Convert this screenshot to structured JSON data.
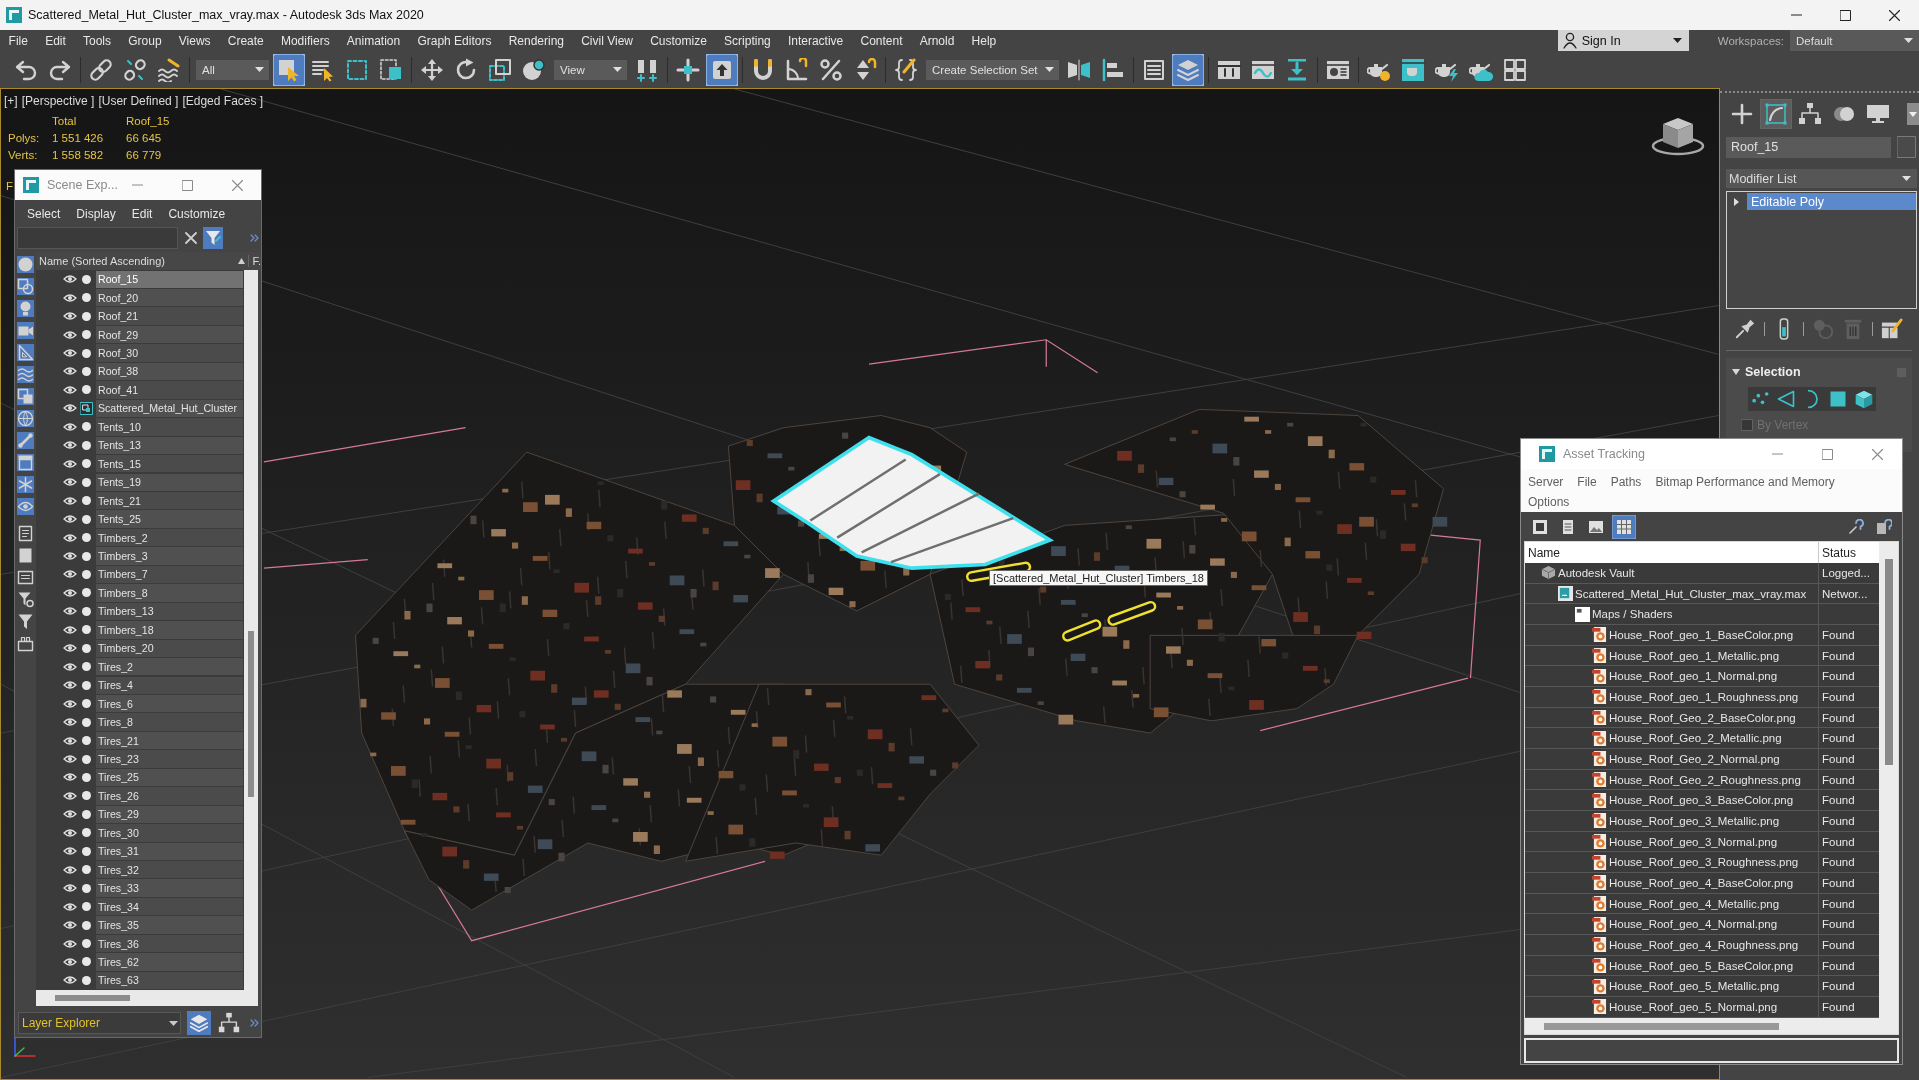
{
  "window": {
    "title": "Scattered_Metal_Hut_Cluster_max_vray.max - Autodesk 3ds Max 2020"
  },
  "menu": [
    "File",
    "Edit",
    "Tools",
    "Group",
    "Views",
    "Create",
    "Modifiers",
    "Animation",
    "Graph Editors",
    "Rendering",
    "Civil View",
    "Customize",
    "Scripting",
    "Interactive",
    "Content",
    "Arnold",
    "Help"
  ],
  "account": {
    "label": "Sign In"
  },
  "workspaces": {
    "label": "Workspaces:",
    "value": "Default"
  },
  "toolbar": [
    {
      "kind": "button",
      "selected": false
    },
    {
      "kind": "button",
      "selected": false
    },
    {
      "kind": "separator"
    },
    {
      "kind": "button",
      "selected": false
    },
    {
      "kind": "button",
      "selected": false
    },
    {
      "kind": "button",
      "selected": false
    },
    {
      "kind": "separator"
    },
    {
      "kind": "dropdown",
      "value": "All"
    },
    {
      "kind": "button",
      "selected": true
    },
    {
      "kind": "button",
      "selected": false
    },
    {
      "kind": "button",
      "selected": false
    },
    {
      "kind": "button",
      "selected": false
    },
    {
      "kind": "separator"
    },
    {
      "kind": "button",
      "selected": false
    },
    {
      "kind": "button",
      "selected": false
    },
    {
      "kind": "button",
      "selected": false
    },
    {
      "kind": "button",
      "selected": false
    },
    {
      "kind": "dropdown",
      "value": "View"
    },
    {
      "kind": "button",
      "selected": false
    },
    {
      "kind": "separator"
    },
    {
      "kind": "button",
      "selected": false
    },
    {
      "kind": "button",
      "selected": true
    },
    {
      "kind": "separator"
    },
    {
      "kind": "button",
      "selected": false
    },
    {
      "kind": "button",
      "selected": false
    },
    {
      "kind": "button",
      "selected": false
    },
    {
      "kind": "button",
      "selected": false
    },
    {
      "kind": "separator"
    },
    {
      "kind": "button",
      "selected": false
    },
    {
      "kind": "dropdown",
      "value": "Create Selection Set"
    },
    {
      "kind": "button",
      "selected": false
    },
    {
      "kind": "button",
      "selected": false
    },
    {
      "kind": "separator"
    },
    {
      "kind": "button",
      "selected": false
    },
    {
      "kind": "button",
      "selected": true
    },
    {
      "kind": "separator"
    },
    {
      "kind": "button",
      "selected": false
    },
    {
      "kind": "button",
      "selected": false
    },
    {
      "kind": "button",
      "selected": false
    },
    {
      "kind": "separator"
    },
    {
      "kind": "button",
      "selected": false
    },
    {
      "kind": "separator"
    },
    {
      "kind": "button",
      "selected": false
    },
    {
      "kind": "button",
      "selected": false
    },
    {
      "kind": "button",
      "selected": false
    },
    {
      "kind": "button",
      "selected": false
    },
    {
      "kind": "button",
      "selected": false
    }
  ],
  "viewport": {
    "labels": [
      "[+]",
      "[Perspective ]",
      "[User Defined ]",
      "[Edged Faces ]"
    ],
    "stats": {
      "columns": [
        "Total",
        "Roof_15"
      ],
      "rows": [
        {
          "label": "Polys:",
          "values": [
            "1 551 426",
            "66 645"
          ]
        },
        {
          "label": "Verts:",
          "values": [
            "1 558 582",
            "66 779"
          ]
        }
      ]
    },
    "partial_label": "F",
    "tooltip": "[Scattered_Metal_Hut_Cluster] Timbers_18"
  },
  "command_panel": {
    "tabs": [
      {
        "selected": false
      },
      {
        "selected": true
      },
      {
        "selected": false
      },
      {
        "selected": false
      },
      {
        "selected": false
      }
    ],
    "object_name": "Roof_15",
    "modifier_list": "Modifier List",
    "stack": [
      {
        "label": "Editable Poly",
        "selected": true,
        "expanded": false
      }
    ],
    "stack_tools": [
      {
        "disabled": false
      },
      {
        "disabled": false
      },
      {
        "disabled": true
      },
      {
        "disabled": true
      },
      {
        "disabled": false
      }
    ],
    "rollout": {
      "title": "Selection",
      "expanded": true,
      "levels": [
        {
          "selected": false
        },
        {
          "selected": false
        },
        {
          "selected": false
        },
        {
          "selected": false
        },
        {
          "selected": false
        }
      ],
      "by_vertex": {
        "label": "By Vertex",
        "checked": false,
        "disabled": true
      }
    }
  },
  "scene_explorer": {
    "title": "Scene Exp...",
    "menu": [
      "Select",
      "Display",
      "Edit",
      "Customize"
    ],
    "filter_toggle": {
      "on": true
    },
    "filters": [
      {
        "on": true
      },
      {
        "on": true
      },
      {
        "on": true
      },
      {
        "on": true
      },
      {
        "on": true
      },
      {
        "on": true
      },
      {
        "on": true
      },
      {
        "on": true
      },
      {
        "on": true
      },
      {
        "on": true
      },
      {
        "on": true
      },
      {
        "on": true
      },
      {
        "on": false
      },
      {
        "on": false
      },
      {
        "on": false
      },
      {
        "on": false
      },
      {
        "on": false
      },
      {
        "on": false
      }
    ],
    "columns": [
      "Name (Sorted Ascending)",
      "F."
    ],
    "rows": [
      {
        "name": "Roof_15",
        "kind": "object",
        "selected": true
      },
      {
        "name": "Roof_20",
        "kind": "object",
        "selected": false
      },
      {
        "name": "Roof_21",
        "kind": "object",
        "selected": false
      },
      {
        "name": "Roof_29",
        "kind": "object",
        "selected": false
      },
      {
        "name": "Roof_30",
        "kind": "object",
        "selected": false
      },
      {
        "name": "Roof_38",
        "kind": "object",
        "selected": false
      },
      {
        "name": "Roof_41",
        "kind": "object",
        "selected": false
      },
      {
        "name": "Scattered_Metal_Hut_Cluster",
        "kind": "container",
        "selected": false
      },
      {
        "name": "Tents_10",
        "kind": "object",
        "selected": false
      },
      {
        "name": "Tents_13",
        "kind": "object",
        "selected": false
      },
      {
        "name": "Tents_15",
        "kind": "object",
        "selected": false
      },
      {
        "name": "Tents_19",
        "kind": "object",
        "selected": false
      },
      {
        "name": "Tents_21",
        "kind": "object",
        "selected": false
      },
      {
        "name": "Tents_25",
        "kind": "object",
        "selected": false
      },
      {
        "name": "Timbers_2",
        "kind": "object",
        "selected": false
      },
      {
        "name": "Timbers_3",
        "kind": "object",
        "selected": false
      },
      {
        "name": "Timbers_7",
        "kind": "object",
        "selected": false
      },
      {
        "name": "Timbers_8",
        "kind": "object",
        "selected": false
      },
      {
        "name": "Timbers_13",
        "kind": "object",
        "selected": false
      },
      {
        "name": "Timbers_18",
        "kind": "object",
        "selected": false
      },
      {
        "name": "Timbers_20",
        "kind": "object",
        "selected": false
      },
      {
        "name": "Tires_2",
        "kind": "object",
        "selected": false
      },
      {
        "name": "Tires_4",
        "kind": "object",
        "selected": false
      },
      {
        "name": "Tires_6",
        "kind": "object",
        "selected": false
      },
      {
        "name": "Tires_8",
        "kind": "object",
        "selected": false
      },
      {
        "name": "Tires_21",
        "kind": "object",
        "selected": false
      },
      {
        "name": "Tires_23",
        "kind": "object",
        "selected": false
      },
      {
        "name": "Tires_25",
        "kind": "object",
        "selected": false
      },
      {
        "name": "Tires_26",
        "kind": "object",
        "selected": false
      },
      {
        "name": "Tires_29",
        "kind": "object",
        "selected": false
      },
      {
        "name": "Tires_30",
        "kind": "object",
        "selected": false
      },
      {
        "name": "Tires_31",
        "kind": "object",
        "selected": false
      },
      {
        "name": "Tires_32",
        "kind": "object",
        "selected": false
      },
      {
        "name": "Tires_33",
        "kind": "object",
        "selected": false
      },
      {
        "name": "Tires_34",
        "kind": "object",
        "selected": false
      },
      {
        "name": "Tires_35",
        "kind": "object",
        "selected": false
      },
      {
        "name": "Tires_36",
        "kind": "object",
        "selected": false
      },
      {
        "name": "Tires_62",
        "kind": "object",
        "selected": false
      },
      {
        "name": "Tires_63",
        "kind": "object",
        "selected": false
      }
    ],
    "layer_dropdown": "Layer Explorer",
    "footer_buttons": [
      {
        "selected": true
      },
      {
        "selected": false
      }
    ]
  },
  "asset_tracking": {
    "title": "Asset Tracking",
    "menu_rows": [
      [
        "Server",
        "File",
        "Paths",
        "Bitmap Performance and Memory"
      ],
      [
        "Options"
      ]
    ],
    "toolbar": [
      {
        "selected": false
      },
      {
        "selected": false
      },
      {
        "selected": false
      },
      {
        "selected": true
      },
      {
        "selected": false
      },
      {
        "selected": false
      }
    ],
    "columns": [
      "Name",
      "Status"
    ],
    "tree": [
      {
        "name": "Autodesk Vault",
        "status": "Logged...",
        "kind": "vault",
        "children": [
          {
            "name": "Scattered_Metal_Hut_Cluster_max_vray.max",
            "status": "Networ...",
            "kind": "scene",
            "children": [
              {
                "name": "Maps / Shaders",
                "kind": "folder",
                "children": [
                  {
                    "name": "House_Roof_geo_1_BaseColor.png",
                    "status": "Found",
                    "kind": "png"
                  },
                  {
                    "name": "House_Roof_geo_1_Metallic.png",
                    "status": "Found",
                    "kind": "png"
                  },
                  {
                    "name": "House_Roof_geo_1_Normal.png",
                    "status": "Found",
                    "kind": "png"
                  },
                  {
                    "name": "House_Roof_geo_1_Roughness.png",
                    "status": "Found",
                    "kind": "png"
                  },
                  {
                    "name": "House_Roof_Geo_2_BaseColor.png",
                    "status": "Found",
                    "kind": "png"
                  },
                  {
                    "name": "House_Roof_Geo_2_Metallic.png",
                    "status": "Found",
                    "kind": "png"
                  },
                  {
                    "name": "House_Roof_Geo_2_Normal.png",
                    "status": "Found",
                    "kind": "png"
                  },
                  {
                    "name": "House_Roof_Geo_2_Roughness.png",
                    "status": "Found",
                    "kind": "png"
                  },
                  {
                    "name": "House_Roof_geo_3_BaseColor.png",
                    "status": "Found",
                    "kind": "png"
                  },
                  {
                    "name": "House_Roof_geo_3_Metallic.png",
                    "status": "Found",
                    "kind": "png"
                  },
                  {
                    "name": "House_Roof_geo_3_Normal.png",
                    "status": "Found",
                    "kind": "png"
                  },
                  {
                    "name": "House_Roof_geo_3_Roughness.png",
                    "status": "Found",
                    "kind": "png"
                  },
                  {
                    "name": "House_Roof_geo_4_BaseColor.png",
                    "status": "Found",
                    "kind": "png"
                  },
                  {
                    "name": "House_Roof_geo_4_Metallic.png",
                    "status": "Found",
                    "kind": "png"
                  },
                  {
                    "name": "House_Roof_geo_4_Normal.png",
                    "status": "Found",
                    "kind": "png"
                  },
                  {
                    "name": "House_Roof_geo_4_Roughness.png",
                    "status": "Found",
                    "kind": "png"
                  },
                  {
                    "name": "House_Roof_geo_5_BaseColor.png",
                    "status": "Found",
                    "kind": "png"
                  },
                  {
                    "name": "House_Roof_geo_5_Metallic.png",
                    "status": "Found",
                    "kind": "png"
                  },
                  {
                    "name": "House_Roof_geo_5_Normal.png",
                    "status": "Found",
                    "kind": "png"
                  }
                ]
              }
            ]
          }
        ]
      }
    ]
  }
}
